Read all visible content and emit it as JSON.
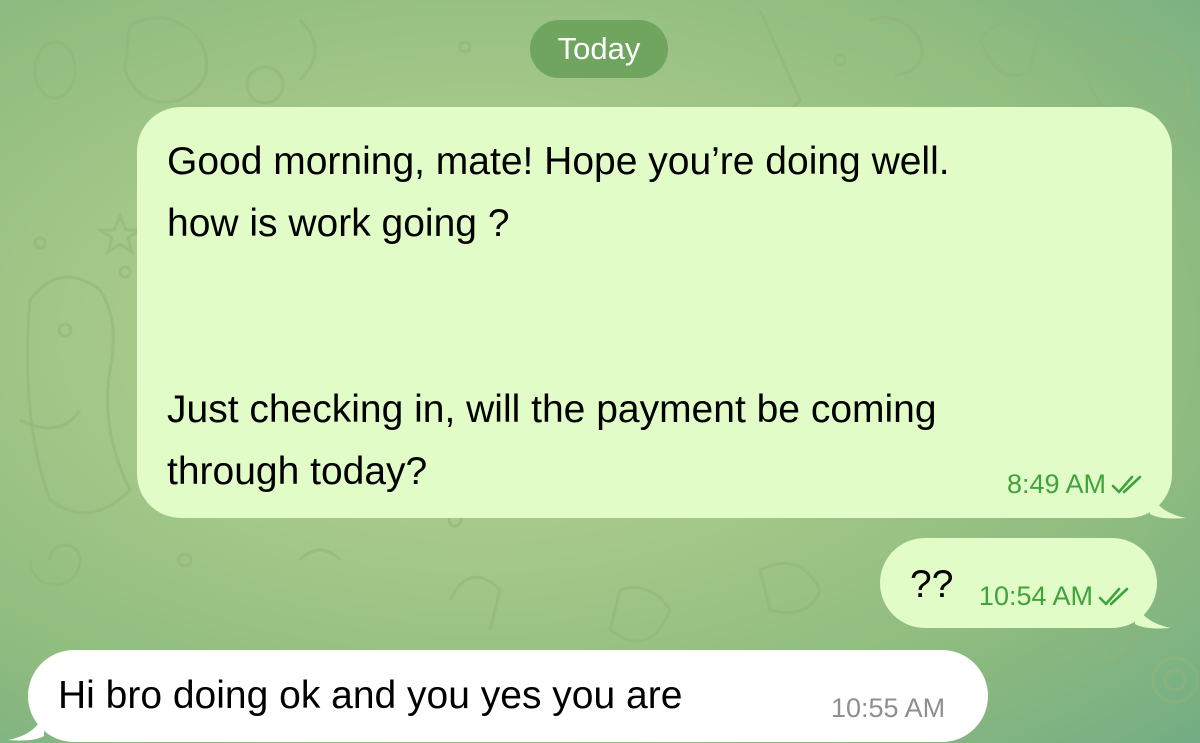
{
  "chat": {
    "date_separator": "Today",
    "messages": [
      {
        "direction": "outgoing",
        "text": "Good morning, mate! Hope you’re doing well.\nhow is work going ?\n\n\nJust checking in,  will the payment be coming\nthrough today?",
        "time": "8:49 AM",
        "status": "read",
        "status_icon": "double-check-icon"
      },
      {
        "direction": "outgoing",
        "text": "??",
        "time": "10:54 AM",
        "status": "read",
        "status_icon": "double-check-icon"
      },
      {
        "direction": "incoming",
        "text": "Hi bro doing ok and you yes you are",
        "time": "10:55 AM"
      }
    ]
  },
  "colors": {
    "outgoing_bubble": "#e2fcc8",
    "incoming_bubble": "#ffffff",
    "date_pill": "#6fa55f",
    "outgoing_meta": "#3fa33b",
    "incoming_meta": "#8e8e93"
  }
}
